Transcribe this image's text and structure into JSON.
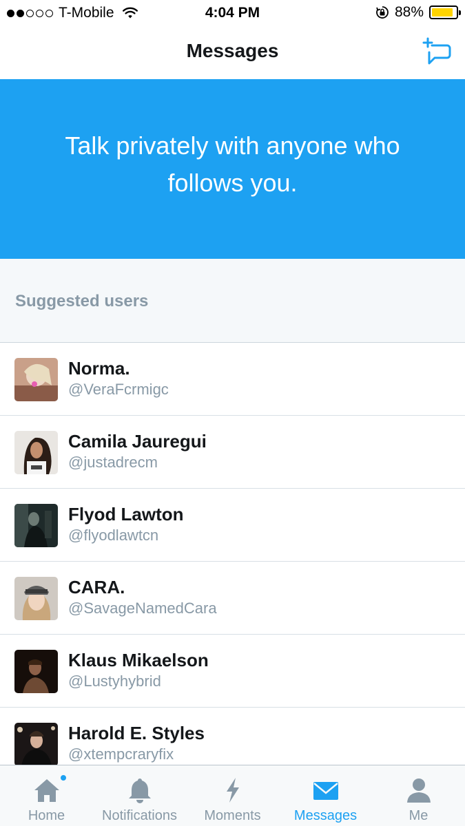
{
  "status_bar": {
    "carrier": "T-Mobile",
    "time": "4:04 PM",
    "battery": "88%",
    "battery_level": 0.88,
    "signal_bars_filled": 2,
    "signal_bars_total": 5
  },
  "nav": {
    "title": "Messages",
    "compose_icon": "new-message-icon"
  },
  "banner": {
    "text": "Talk privately with anyone who follows you."
  },
  "suggested": {
    "label": "Suggested users",
    "users": [
      {
        "name": "Norma.",
        "handle": "@VeraFcrmigc"
      },
      {
        "name": "Camila Jauregui",
        "handle": "@justadrecm"
      },
      {
        "name": "Flyod Lawton",
        "handle": "@flyodlawtcn"
      },
      {
        "name": "CARA.",
        "handle": "@SavageNamedCara"
      },
      {
        "name": "Klaus Mikaelson",
        "handle": "@Lustyhybrid"
      },
      {
        "name": "Harold E. Styles",
        "handle": "@xtempcraryfix"
      }
    ]
  },
  "tabs": [
    {
      "label": "Home",
      "icon": "home-icon"
    },
    {
      "label": "Notifications",
      "icon": "bell-icon"
    },
    {
      "label": "Moments",
      "icon": "lightning-icon"
    },
    {
      "label": "Messages",
      "icon": "envelope-icon"
    },
    {
      "label": "Me",
      "icon": "person-icon"
    }
  ],
  "colors": {
    "accent": "#1da1f2",
    "secondary_text": "#8899a6",
    "battery": "#ffd400"
  }
}
